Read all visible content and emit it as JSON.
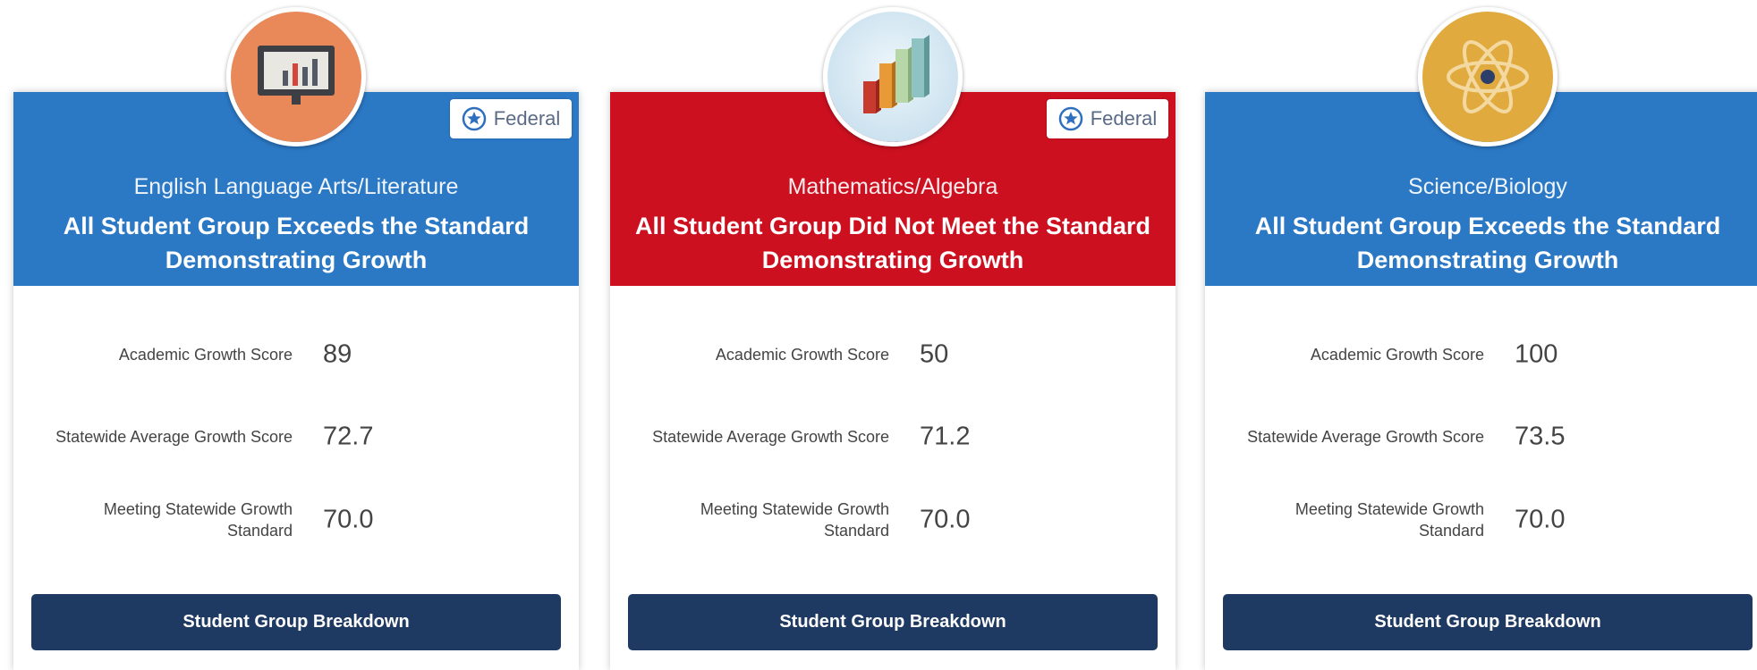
{
  "colors": {
    "on_track": "#2b78c5",
    "off_track": "#cc1020",
    "button": "#1f3a62",
    "badge_text": "#5a6b86"
  },
  "cards": [
    {
      "icon": "presentation-chart-icon",
      "badge": "Federal",
      "subject": "English Language Arts/Literature",
      "status": "All Student Group Exceeds the Standard Demonstrating Growth",
      "metrics": [
        {
          "label": "Academic Growth Score",
          "value": "89"
        },
        {
          "label": "Statewide Average Growth Score",
          "value": "72.7"
        },
        {
          "label": "Meeting Statewide Growth Standard",
          "value": "70.0"
        }
      ],
      "button": "Student Group Breakdown"
    },
    {
      "icon": "bar-graph-icon",
      "badge": "Federal",
      "subject": "Mathematics/Algebra",
      "status": "All Student Group Did Not Meet the Standard Demonstrating Growth",
      "metrics": [
        {
          "label": "Academic Growth Score",
          "value": "50"
        },
        {
          "label": "Statewide Average Growth Score",
          "value": "71.2"
        },
        {
          "label": "Meeting Statewide Growth Standard",
          "value": "70.0"
        }
      ],
      "button": "Student Group Breakdown"
    },
    {
      "icon": "atom-icon",
      "badge": "",
      "subject": "Science/Biology",
      "status": "All Student Group Exceeds the Standard Demonstrating Growth",
      "metrics": [
        {
          "label": "Academic Growth Score",
          "value": "100"
        },
        {
          "label": "Statewide Average Growth Score",
          "value": "73.5"
        },
        {
          "label": "Meeting Statewide Growth Standard",
          "value": "70.0"
        }
      ],
      "button": "Student Group Breakdown"
    }
  ]
}
